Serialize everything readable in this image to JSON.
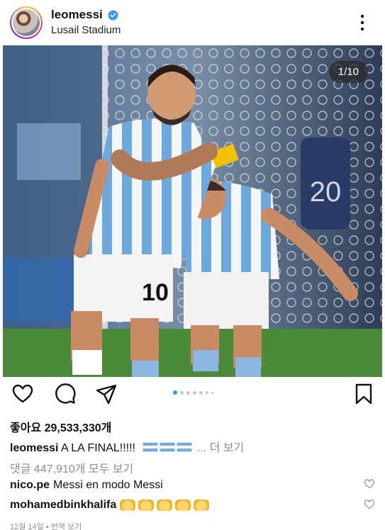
{
  "post": {
    "username": "leomessi",
    "location": "Lusail Stadium",
    "image_counter": "1/10",
    "carousel_dots": 7,
    "carousel_active": 0
  },
  "colors": {
    "verified": "#3897f0",
    "accent_dot": "#3897f0",
    "muted": "#8e8e8e"
  },
  "icons": [
    "verified-badge-icon",
    "more-options-icon",
    "heart-icon",
    "comment-icon",
    "share-icon",
    "bookmark-icon"
  ],
  "stats": {
    "likes": "좋아요 29,533,330개"
  },
  "caption": {
    "username": "leomessi",
    "text": "A LA FINAL!!!!!",
    "more": "... 더 보기"
  },
  "comments_link": "댓글 447,910개 모두 보기",
  "comments": [
    {
      "username": "nico.pe",
      "text": "Messi en modo Messi"
    },
    {
      "username": "mohamedbinkhalifa",
      "text": ""
    }
  ],
  "footer": {
    "date": "12월 14일",
    "separator": "•",
    "translate": "번역 보기"
  }
}
